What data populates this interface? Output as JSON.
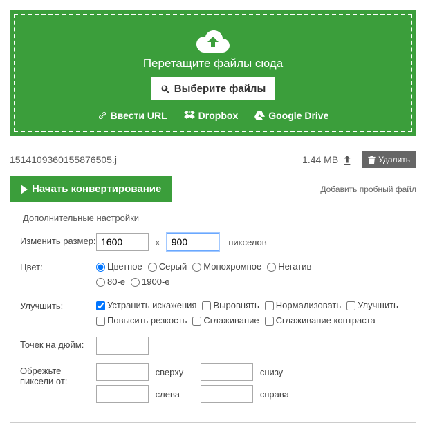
{
  "dropzone": {
    "title": "Перетащите файлы сюда",
    "select_btn": "Выберите файлы",
    "url_link": "Ввести URL",
    "dropbox_link": "Dropbox",
    "gdrive_link": "Google Drive"
  },
  "file": {
    "name": "1514109360155876505.j",
    "size": "1.44 MB",
    "delete_label": "Удалить"
  },
  "actions": {
    "convert_label": "Начать конвертирование",
    "add_test_label": "Добавить пробный файл"
  },
  "settings": {
    "legend": "Дополнительные настройки",
    "resize": {
      "label": "Изменить размер:",
      "width": "1600",
      "height": "900",
      "unit": "пикселов"
    },
    "color": {
      "label": "Цвет:",
      "options": [
        "Цветное",
        "Серый",
        "Монохромное",
        "Негатив",
        "80-е",
        "1900-е"
      ],
      "selected": 0
    },
    "enhance": {
      "label": "Улучшить:",
      "options": [
        "Устранить искажения",
        "Выровнять",
        "Нормализовать",
        "Улучшить",
        "Повысить резкость",
        "Сглаживание",
        "Сглаживание контраста"
      ],
      "checked": [
        true,
        false,
        false,
        false,
        false,
        false,
        false
      ]
    },
    "dpi": {
      "label": "Точек на дюйм:",
      "value": ""
    },
    "crop": {
      "label": "Обрежьте пиксели от:",
      "top_label": "сверху",
      "bottom_label": "снизу",
      "left_label": "слева",
      "right_label": "справа",
      "top": "",
      "bottom": "",
      "left": "",
      "right": ""
    }
  }
}
